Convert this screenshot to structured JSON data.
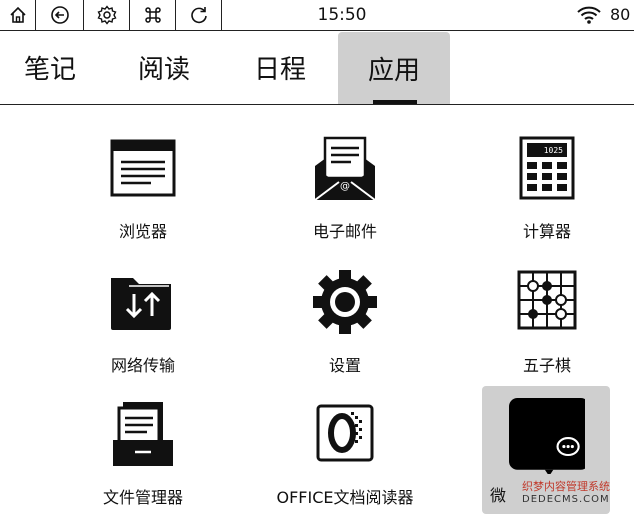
{
  "status_bar": {
    "time": "15:50",
    "battery": "80",
    "icons": [
      "home-icon",
      "back-icon",
      "settings-icon",
      "command-icon",
      "refresh-icon",
      "wifi-icon"
    ]
  },
  "tabs": [
    {
      "label": "笔记",
      "active": false
    },
    {
      "label": "阅读",
      "active": false
    },
    {
      "label": "日程",
      "active": false
    },
    {
      "label": "应用",
      "active": true
    }
  ],
  "apps": [
    {
      "label": "浏览器",
      "icon": "browser-icon"
    },
    {
      "label": "电子邮件",
      "icon": "email-icon"
    },
    {
      "label": "计算器",
      "icon": "calculator-icon",
      "display": "1025"
    },
    {
      "label": "网络传输",
      "icon": "network-transfer-icon"
    },
    {
      "label": "设置",
      "icon": "settings-gear-icon"
    },
    {
      "label": "五子棋",
      "icon": "gomoku-icon"
    },
    {
      "label": "文件管理器",
      "icon": "file-manager-icon"
    },
    {
      "label": "OFFICE文档阅读器",
      "icon": "office-reader-icon"
    },
    {
      "label": "微",
      "icon": "wechat-icon"
    }
  ],
  "watermark": {
    "line1": "织梦内容管理系统",
    "line2": "DEDECMS.COM"
  },
  "colors": {
    "selected_bg": "#cfcfcf",
    "ink": "#111111",
    "watermark": "#c0392b"
  }
}
